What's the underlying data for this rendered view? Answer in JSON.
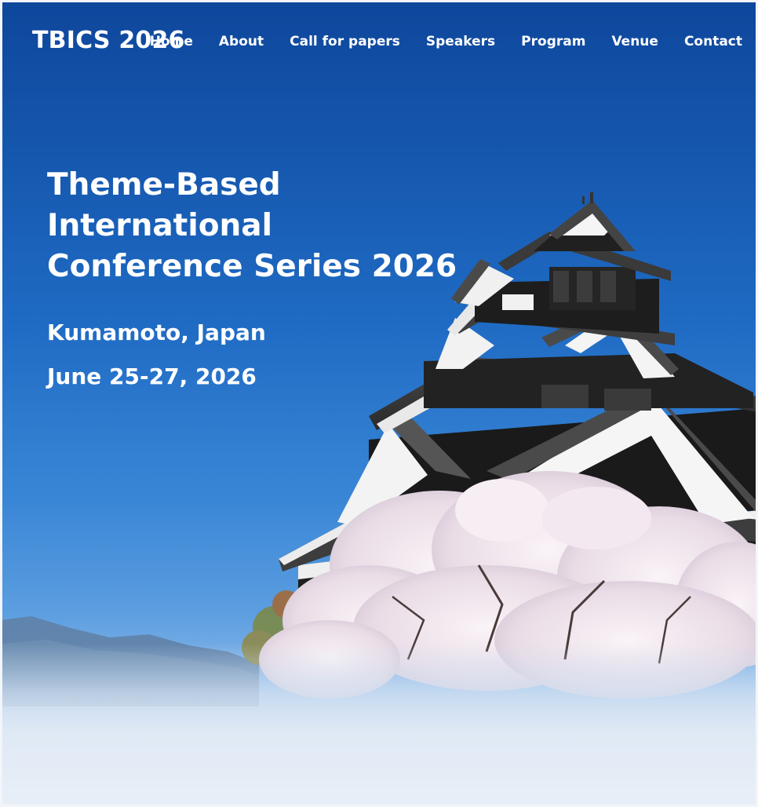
{
  "brand": {
    "title": "TBICS 2026"
  },
  "nav": {
    "items": [
      {
        "label": "Home"
      },
      {
        "label": "About"
      },
      {
        "label": "Call for papers"
      },
      {
        "label": "Speakers"
      },
      {
        "label": "Program"
      },
      {
        "label": "Venue"
      },
      {
        "label": "Contact"
      }
    ]
  },
  "hero": {
    "title_line1": "Theme-Based International",
    "title_line2": "Conference Series 2026",
    "location": "Kumamoto, Japan",
    "date": "June 25-27, 2026"
  },
  "colors": {
    "sky_top": "#0e479c",
    "sky_mid": "#3a86d6",
    "text": "#ffffff",
    "castle_dark": "#1c1c1c",
    "castle_white": "#f4f4f4",
    "blossom": "#efe4ec"
  },
  "image": {
    "subject": "castle-with-cherry-blossoms"
  }
}
